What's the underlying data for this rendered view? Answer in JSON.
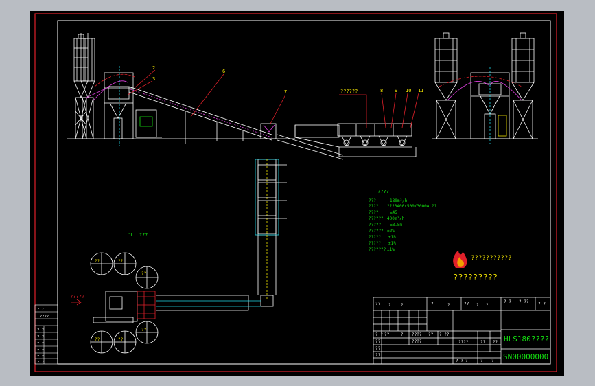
{
  "drawing": {
    "background": "#000000",
    "frame_color": "#e0202a",
    "line_color": "#ffffff",
    "accent_yellow": "#f2e400",
    "accent_green": "#14e010",
    "accent_cyan": "#22d8e8",
    "accent_magenta": "#e040e0"
  },
  "callouts": {
    "n2": "2",
    "n3": "3",
    "n6": "6",
    "n7": "7",
    "n8": "8",
    "n9": "9",
    "n10": "10",
    "n11": "11",
    "bin_label": "??????"
  },
  "plan_labels": {
    "view_label": "'L' ???",
    "arrow_label": "?????"
  },
  "spec": {
    "title": "????",
    "rows": [
      {
        "k": "???",
        "v": "180m³/h"
      },
      {
        "k": "????",
        "v": "???3400x500/3000A ??"
      },
      {
        "k": "????",
        "v": "≤45"
      },
      {
        "k": "??????",
        "v": "400m³/h"
      },
      {
        "k": "?????",
        "v": "≤8.5m"
      },
      {
        "k": "??????",
        "v": "±2%"
      },
      {
        "k": "?????",
        "v": "±1%"
      },
      {
        "k": "?????",
        "v": "±1%"
      },
      {
        "k": "???????",
        "v": "±1%"
      }
    ]
  },
  "brand": {
    "name": "???????????",
    "subtitle": "?????????"
  },
  "title_block": {
    "r1c1": "??",
    "r1c2": "?",
    "r1c3": "?",
    "r1c4": "?",
    "r1c5": "?",
    "r1c6": "??",
    "r1c7": "?",
    "r1c8": "?",
    "r1c9": "? ?",
    "r1c10": "? ??",
    "r1c11": "? ?",
    "r5a": "? ?",
    "r5b": "??",
    "r5c": "?",
    "r5d": "????",
    "r5e": "??",
    "r5f": "? ??",
    "r6a": "??",
    "r6b": "????",
    "r6c": "??",
    "r6d": "??",
    "r7a": "??",
    "r8a": "??",
    "r9a": "? ?",
    "r9b": "?",
    "r9c": "?",
    "r9d": "?",
    "model": "HLS180????",
    "serial": "SN00000000"
  },
  "left_table": {
    "rows": [
      "? ?",
      "????",
      "",
      "? ?",
      "? ?",
      "? ?",
      "? ?",
      "? ?",
      "? ?",
      "? ?"
    ]
  }
}
